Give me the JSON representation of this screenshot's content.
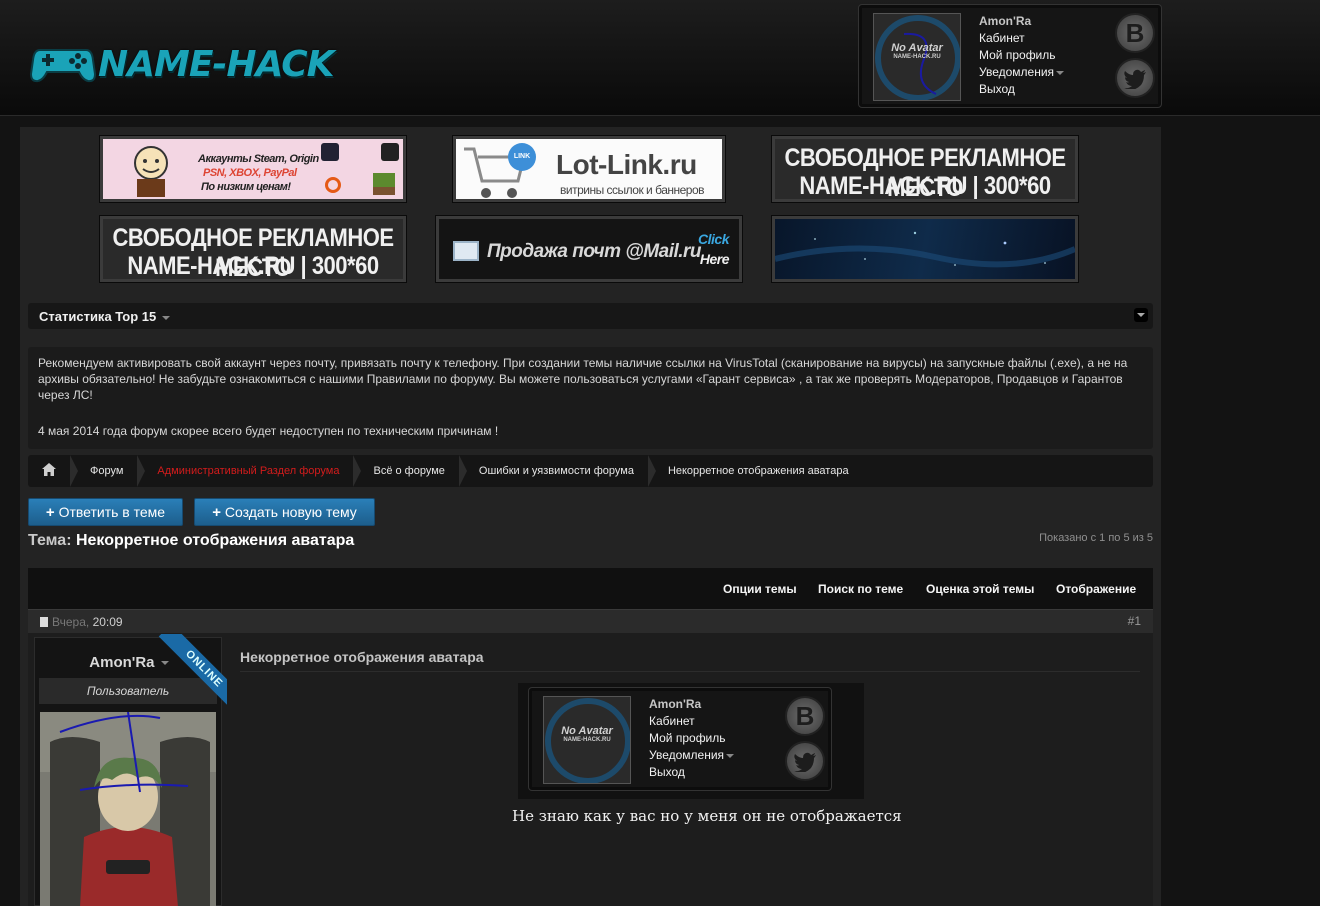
{
  "header": {
    "logo_text": "NAME-HACK",
    "user": {
      "name": "Amon'Ra",
      "links": [
        "Кабинет",
        "Мой профиль",
        "Уведомления",
        "Выход"
      ],
      "avatar_text": "No Avatar",
      "avatar_sub": "NAME-HACK.RU"
    },
    "social": [
      "B",
      "bird"
    ]
  },
  "banners": [
    {
      "line1": "Аккаунты Steam, Origin",
      "line2": "PSN, XBOX, PayPal",
      "line3": "По низким ценам!"
    },
    {
      "line1": "Lot-Link.ru",
      "line2": "витрины ссылок и баннеров",
      "badge": "LINK"
    },
    {
      "line1": "СВОБОДНОЕ РЕКЛАМНОЕ МЕСТО",
      "line2": "NAME-HACK.RU | 300*60"
    },
    {
      "line1": "СВОБОДНОЕ РЕКЛАМНОЕ МЕСТО",
      "line2": "NAME-HACK.RU | 300*60"
    },
    {
      "line1": "Продажа почт @Mail.ru",
      "line2": "Click",
      "line3": "Here"
    },
    {
      "line1": ""
    }
  ],
  "stats": {
    "title": "Статистика Top 15"
  },
  "notice": {
    "p1": "Рекомендуем активировать свой аккаунт через почту, привязать почту к телефону. При создании темы наличие ссылки на VirusTotal (сканирование на вирусы) на запускные файлы (.exe), а не на архивы обязательно! Не забудьте ознакомиться с нашими Правилами по форуму. Вы можете пользоваться услугами «Гарант сервиса» , а так же проверять Модераторов, Продавцов и Гарантов через ЛС!",
    "p2": "4 мая 2014 года форум скорее всего будет недоступен по техническим причинам !"
  },
  "breadcrumb": [
    "Форум",
    "Административный Раздел форума",
    "Всё о форуме",
    "Ошибки и уязвимости форума",
    "Некорретное отображения аватара"
  ],
  "buttons": {
    "reply": "Ответить в теме",
    "new_thread": "Создать новую тему",
    "plus": "+"
  },
  "thread": {
    "label": "Тема:",
    "title": "Некорретное отображения аватара",
    "shown": "Показано с 1 по 5 из 5"
  },
  "tools": [
    "Опции темы",
    "Поиск по теме",
    "Оценка этой темы",
    "Отображение"
  ],
  "post": {
    "date_ago": "Вчера,",
    "time": "20:09",
    "number": "#1",
    "author": "Amon'Ra",
    "role": "Пользователь",
    "online": "ONLINE",
    "subject": "Некорретное отображения аватара",
    "text": "Не знаю как у вас но у меня он не отображается"
  }
}
